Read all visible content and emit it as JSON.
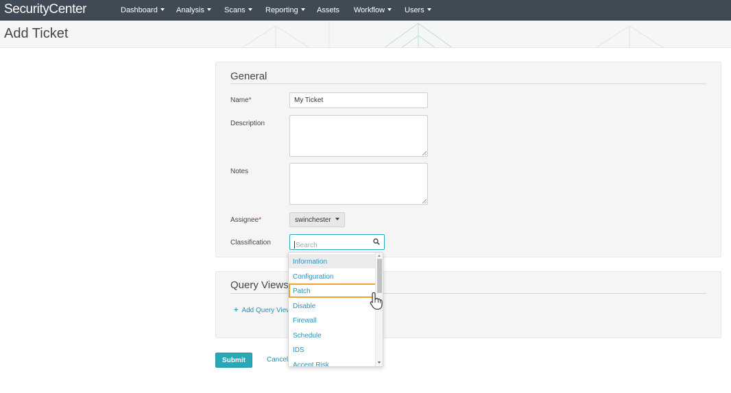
{
  "app": {
    "brand": "SecurityCenter",
    "nav": [
      {
        "label": "Dashboard",
        "has_caret": true
      },
      {
        "label": "Analysis",
        "has_caret": true
      },
      {
        "label": "Scans",
        "has_caret": true
      },
      {
        "label": "Reporting",
        "has_caret": true
      },
      {
        "label": "Assets",
        "has_caret": false
      },
      {
        "label": "Workflow",
        "has_caret": true
      },
      {
        "label": "Users",
        "has_caret": true
      }
    ]
  },
  "page": {
    "title": "Add Ticket"
  },
  "general": {
    "title": "General",
    "name_label": "Name",
    "required_mark": "*",
    "name_value": "My Ticket",
    "description_label": "Description",
    "notes_label": "Notes",
    "assignee_label": "Assignee",
    "assignee_value": "swinchester",
    "classification_label": "Classification",
    "search_placeholder": "Search"
  },
  "classification_options": [
    {
      "label": "Information",
      "state": "hover"
    },
    {
      "label": "Configuration",
      "state": "normal"
    },
    {
      "label": "Patch",
      "state": "selected"
    },
    {
      "label": "Disable",
      "state": "normal"
    },
    {
      "label": "Firewall",
      "state": "normal"
    },
    {
      "label": "Schedule",
      "state": "normal"
    },
    {
      "label": "IDS",
      "state": "normal"
    },
    {
      "label": "Accept Risk",
      "state": "normal"
    }
  ],
  "query_views": {
    "title": "Query Views",
    "add_label": "Add Query View",
    "add_icon": "plus-icon"
  },
  "actions": {
    "submit_label": "Submit",
    "cancel_label": "Cancel"
  },
  "colors": {
    "nav_bg": "#3f4a55",
    "accent": "#2aa7b6",
    "link": "#2a8fb8",
    "highlight": "#f1a22b",
    "required": "#c0392b"
  }
}
